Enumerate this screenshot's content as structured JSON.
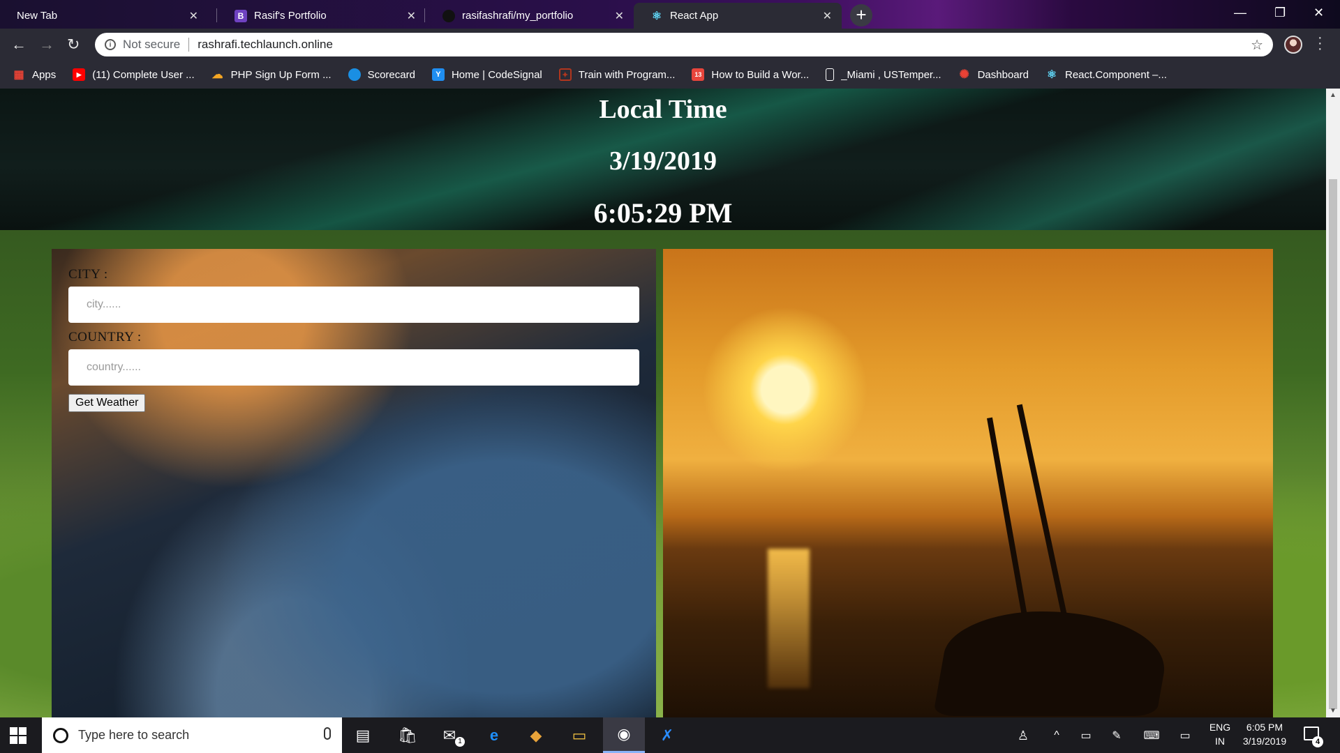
{
  "browser": {
    "tabs": [
      {
        "title": "New Tab",
        "favicon": "none",
        "active": false
      },
      {
        "title": "Rasif's Portfolio",
        "favicon": "bootstrap-icon",
        "favicon_text": "B",
        "active": false
      },
      {
        "title": "rasifashrafi/my_portfolio",
        "favicon": "github-icon",
        "active": false
      },
      {
        "title": "React App",
        "favicon": "react-icon",
        "active": true
      }
    ],
    "omnibox": {
      "security_label": "Not secure",
      "url": "rashrafi.techlaunch.online"
    },
    "bookmarks": [
      {
        "label": "Apps",
        "icon": "apps-grid-icon",
        "color": "#e94235"
      },
      {
        "label": "(11) Complete User ...",
        "icon": "youtube-icon",
        "color": "#ff0000"
      },
      {
        "label": "PHP Sign Up Form ...",
        "icon": "cloud-icon",
        "color": "#f5a623"
      },
      {
        "label": "Scorecard",
        "icon": "circle-icon",
        "color": "#1a8fe3"
      },
      {
        "label": "Home | CodeSignal",
        "icon": "codesignal-icon",
        "color": "#1f8ef1"
      },
      {
        "label": "Train with Program...",
        "icon": "codewars-icon",
        "color": "#b1361e"
      },
      {
        "label": "How to Build a Wor...",
        "icon": "calendar-icon",
        "color": "#e8453c"
      },
      {
        "label": "_Miami , USTemper...",
        "icon": "page-icon",
        "color": "#ffffff"
      },
      {
        "label": "Dashboard",
        "icon": "gear-red-icon",
        "color": "#e94235"
      },
      {
        "label": "React.Component –...",
        "icon": "react-icon",
        "color": "#61dafb"
      }
    ]
  },
  "page": {
    "header": {
      "title": "Local Time",
      "date": "3/19/2019",
      "time": "6:05:29 PM"
    },
    "form": {
      "city_label": "CITY :",
      "city_placeholder": "city......",
      "country_label": "COUNTRY :",
      "country_placeholder": "country......",
      "submit_label": "Get Weather"
    }
  },
  "taskbar": {
    "search_placeholder": "Type here to search",
    "mail_badge": "1",
    "language": "ENG",
    "region": "IN",
    "clock_time": "6:05 PM",
    "clock_date": "3/19/2019",
    "notification_count": "4"
  }
}
